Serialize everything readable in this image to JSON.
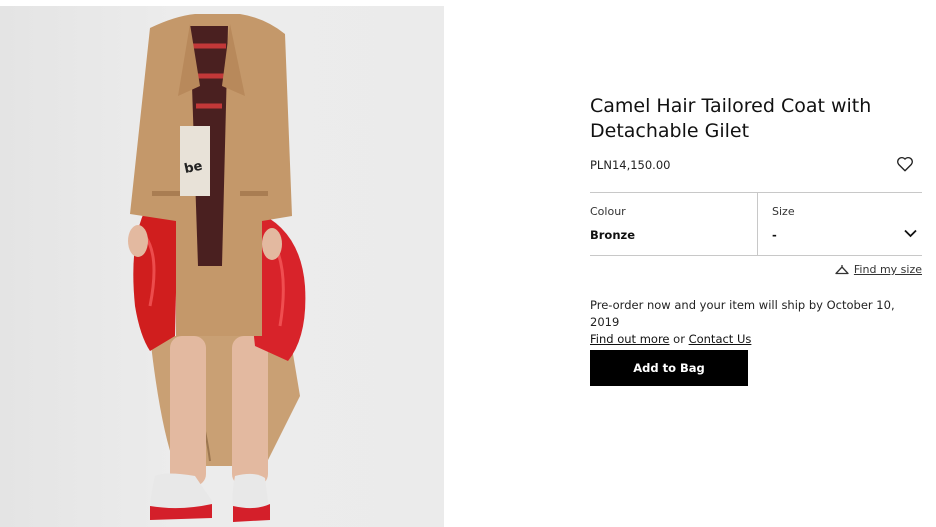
{
  "product": {
    "title": "Camel Hair Tailored Coat with Detachable Gilet",
    "price": "PLN14,150.00",
    "image_icon": "product-photo-coat"
  },
  "options": {
    "colour_label": "Colour",
    "colour_value": "Bronze",
    "size_label": "Size",
    "size_value": "-"
  },
  "fit": {
    "link_label": "Find my size"
  },
  "preorder": {
    "message": "Pre-order now and your item will ship by October 10, 2019",
    "find_out_more": "Find out more",
    "or": "or",
    "contact_us": "Contact Us"
  },
  "actions": {
    "add_to_bag": "Add to Bag"
  },
  "colors": {
    "button_bg": "#000000",
    "coat": "#c49a6c",
    "gilet_red": "#d21f1f",
    "background": "#ffffff"
  }
}
